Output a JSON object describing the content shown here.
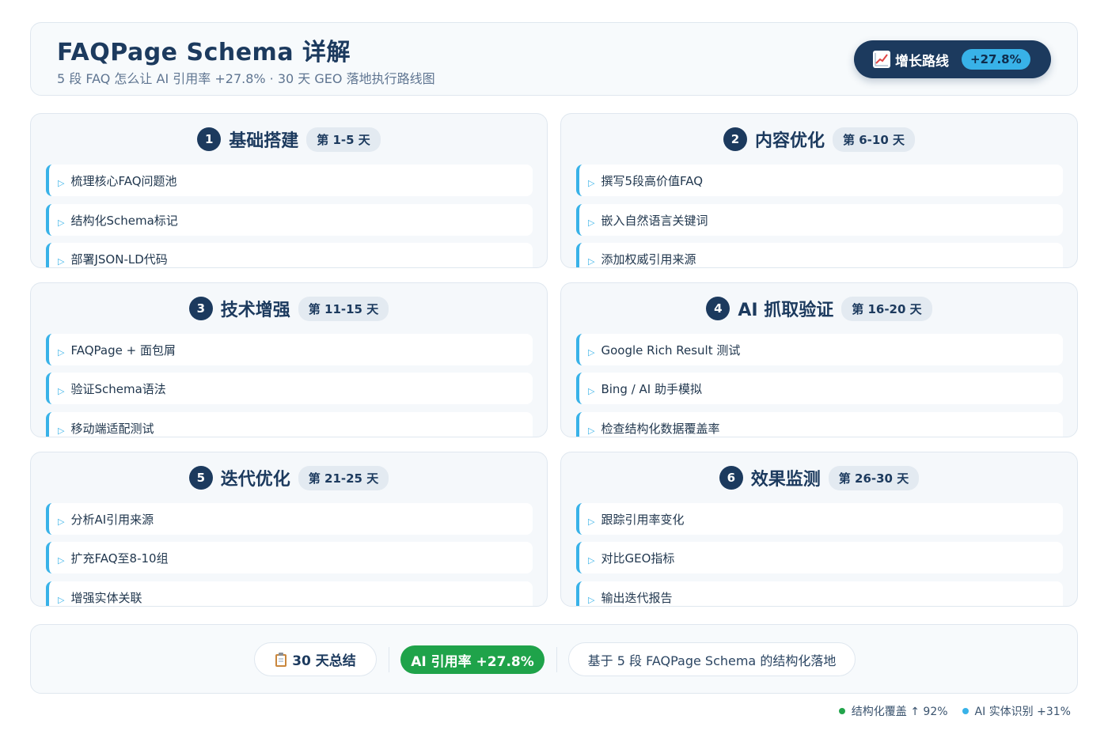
{
  "header": {
    "title": "FAQPage Schema 详解",
    "subtitle": "5 段 FAQ 怎么让 AI 引用率 +27.8% · 30 天 GEO 落地执行路线图",
    "growth_label": "增长路线",
    "growth_value": "+27.8%",
    "growth_icon": "chart-increasing-icon"
  },
  "phases": [
    {
      "num": "1",
      "title": "基础搭建",
      "days": "第 1-5 天",
      "tasks": [
        "梳理核心FAQ问题池",
        "结构化Schema标记",
        "部署JSON-LD代码"
      ]
    },
    {
      "num": "2",
      "title": "内容优化",
      "days": "第 6-10 天",
      "tasks": [
        "撰写5段高价值FAQ",
        "嵌入自然语言关键词",
        "添加权威引用来源"
      ]
    },
    {
      "num": "3",
      "title": "技术增强",
      "days": "第 11-15 天",
      "tasks": [
        "FAQPage + 面包屑",
        "验证Schema语法",
        "移动端适配测试"
      ]
    },
    {
      "num": "4",
      "title": "AI 抓取验证",
      "days": "第 16-20 天",
      "tasks": [
        "Google Rich Result 测试",
        "Bing / AI 助手模拟",
        "检查结构化数据覆盖率"
      ]
    },
    {
      "num": "5",
      "title": "迭代优化",
      "days": "第 21-25 天",
      "tasks": [
        "分析AI引用来源",
        "扩充FAQ至8-10组",
        "增强实体关联"
      ]
    },
    {
      "num": "6",
      "title": "效果监测",
      "days": "第 26-30 天",
      "tasks": [
        "跟踪引用率变化",
        "对比GEO指标",
        "输出迭代报告"
      ]
    }
  ],
  "summary": {
    "label": "30 天总结",
    "label_icon": "clipboard-icon",
    "rate": "AI 引用率 +27.8%",
    "description": "基于 5 段 FAQPage Schema 的结构化落地"
  },
  "legend": [
    {
      "text": "结构化覆盖 ↑ 92%",
      "color": "#22a44b"
    },
    {
      "text": "AI 实体识别 +31%",
      "color": "#38b2e8"
    }
  ],
  "colors": {
    "navy": "#1c3a5e",
    "accent_blue": "#38b2e8",
    "success_green": "#1fa34a"
  }
}
